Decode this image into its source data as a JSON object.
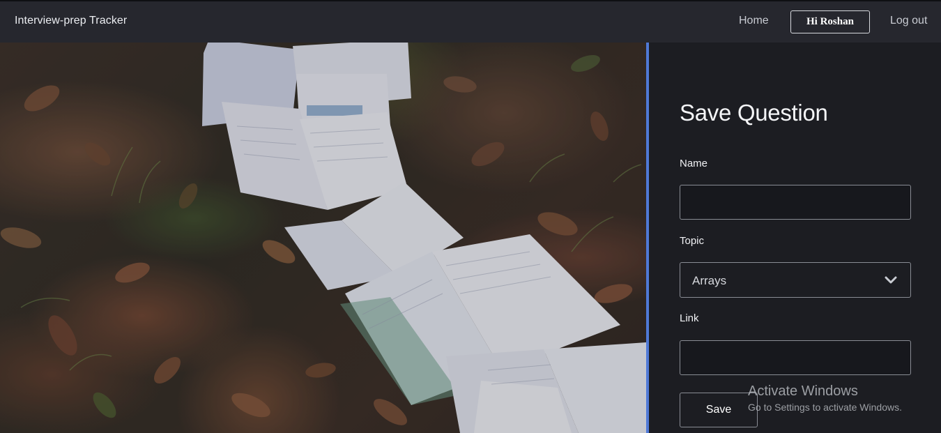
{
  "navbar": {
    "brand": "Interview-prep Tracker",
    "home_label": "Home",
    "user_label": "Hi Roshan",
    "logout_label": "Log out"
  },
  "hero": {
    "image": "open-books-on-autumn-leaves"
  },
  "form": {
    "title": "Save Question",
    "name_label": "Name",
    "name_value": "",
    "topic_label": "Topic",
    "topic_selected": "Arrays",
    "link_label": "Link",
    "link_value": "",
    "save_label": "Save"
  },
  "watermark": {
    "title": "Activate Windows",
    "subtitle": "Go to Settings to activate Windows."
  },
  "colors": {
    "navbar_bg": "#26272e",
    "panel_bg": "#1c1d22",
    "accent_divider": "#4f79d6",
    "input_border": "#8a8d95"
  }
}
